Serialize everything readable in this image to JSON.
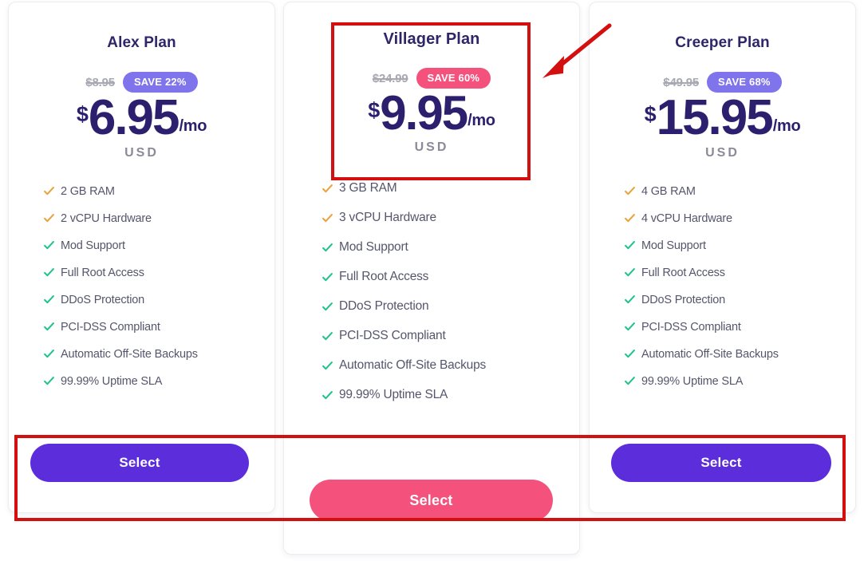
{
  "theme": {
    "purple_accent": "#5c2edb",
    "badge_purple": "#7f74ec",
    "pink_accent": "#f4517c",
    "price_color": "#2c1f6e",
    "check_orange": "#e8a33d",
    "check_green": "#22c38a",
    "annotation_red": "#d40f0f"
  },
  "plans": [
    {
      "id": "alex",
      "name": "Alex Plan",
      "old_price": "$8.95",
      "save_badge": "SAVE 22%",
      "badge_color": "#7f74ec",
      "currency_symbol": "$",
      "amount": "6.95",
      "period": "/mo",
      "currency_code": "USD",
      "features": [
        {
          "label": "2 GB RAM",
          "check": "check-icon",
          "check_color": "#e8a33d"
        },
        {
          "label": "2 vCPU Hardware",
          "check": "check-icon",
          "check_color": "#e8a33d"
        },
        {
          "label": "Mod Support",
          "check": "check-icon",
          "check_color": "#22c38a"
        },
        {
          "label": "Full Root Access",
          "check": "check-icon",
          "check_color": "#22c38a"
        },
        {
          "label": "DDoS Protection",
          "check": "check-icon",
          "check_color": "#22c38a"
        },
        {
          "label": "PCI-DSS Compliant",
          "check": "check-icon",
          "check_color": "#22c38a"
        },
        {
          "label": "Automatic Off-Site Backups",
          "check": "check-icon",
          "check_color": "#22c38a"
        },
        {
          "label": "99.99% Uptime SLA",
          "check": "check-icon",
          "check_color": "#22c38a"
        }
      ],
      "select_label": "Select",
      "select_color": "#5c2edb"
    },
    {
      "id": "villager",
      "name": "Villager Plan",
      "old_price": "$24.99",
      "save_badge": "SAVE 60%",
      "badge_color": "#f4517c",
      "currency_symbol": "$",
      "amount": "9.95",
      "period": "/mo",
      "currency_code": "USD",
      "features": [
        {
          "label": "3 GB RAM",
          "check": "check-icon",
          "check_color": "#e8a33d"
        },
        {
          "label": "3 vCPU Hardware",
          "check": "check-icon",
          "check_color": "#e8a33d"
        },
        {
          "label": "Mod Support",
          "check": "check-icon",
          "check_color": "#22c38a"
        },
        {
          "label": "Full Root Access",
          "check": "check-icon",
          "check_color": "#22c38a"
        },
        {
          "label": "DDoS Protection",
          "check": "check-icon",
          "check_color": "#22c38a"
        },
        {
          "label": "PCI-DSS Compliant",
          "check": "check-icon",
          "check_color": "#22c38a"
        },
        {
          "label": "Automatic Off-Site Backups",
          "check": "check-icon",
          "check_color": "#22c38a"
        },
        {
          "label": "99.99% Uptime SLA",
          "check": "check-icon",
          "check_color": "#22c38a"
        }
      ],
      "select_label": "Select",
      "select_color": "#f4517c"
    },
    {
      "id": "creeper",
      "name": "Creeper Plan",
      "old_price": "$49.95",
      "save_badge": "SAVE 68%",
      "badge_color": "#7f74ec",
      "currency_symbol": "$",
      "amount": "15.95",
      "period": "/mo",
      "currency_code": "USD",
      "features": [
        {
          "label": "4 GB RAM",
          "check": "check-icon",
          "check_color": "#e8a33d"
        },
        {
          "label": "4 vCPU Hardware",
          "check": "check-icon",
          "check_color": "#e8a33d"
        },
        {
          "label": "Mod Support",
          "check": "check-icon",
          "check_color": "#22c38a"
        },
        {
          "label": "Full Root Access",
          "check": "check-icon",
          "check_color": "#22c38a"
        },
        {
          "label": "DDoS Protection",
          "check": "check-icon",
          "check_color": "#22c38a"
        },
        {
          "label": "PCI-DSS Compliant",
          "check": "check-icon",
          "check_color": "#22c38a"
        },
        {
          "label": "Automatic Off-Site Backups",
          "check": "check-icon",
          "check_color": "#22c38a"
        },
        {
          "label": "99.99% Uptime SLA",
          "check": "check-icon",
          "check_color": "#22c38a"
        }
      ],
      "select_label": "Select",
      "select_color": "#5c2edb"
    }
  ],
  "annotations": [
    {
      "id": "villager-price-highlight",
      "shape": "rectangle",
      "color": "#d40f0f"
    },
    {
      "id": "select-buttons-highlight",
      "shape": "rectangle",
      "color": "#d40f0f"
    },
    {
      "id": "pointer",
      "shape": "arrow",
      "color": "#d40f0f"
    }
  ]
}
